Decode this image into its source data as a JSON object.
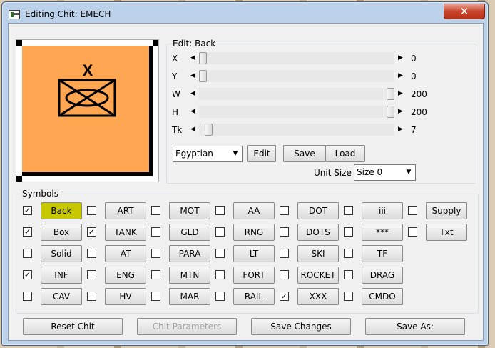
{
  "window": {
    "title": "Editing Chit: EMECH",
    "close_label": "✕"
  },
  "background_tiles": [
    "4 5 5",
    "4 5 5",
    "6 5 9",
    "3 2 12",
    "4 7"
  ],
  "preview": {
    "unit_mark": "X",
    "fill_color": "#fea651"
  },
  "edit_group": {
    "title": "Edit: Back",
    "sliders": [
      {
        "label": "X",
        "value": "0",
        "level": 0.0
      },
      {
        "label": "Y",
        "value": "0",
        "level": 0.0
      },
      {
        "label": "W",
        "value": "200",
        "level": 1.0
      },
      {
        "label": "H",
        "value": "200",
        "level": 1.0
      },
      {
        "label": "Tk",
        "value": "7",
        "level": 0.03
      }
    ],
    "nationality": "Egyptian",
    "edit_label": "Edit",
    "save_label": "Save",
    "load_label": "Load",
    "unit_size_label": "Unit Size",
    "unit_size_value": "Size 0"
  },
  "symbols": {
    "title": "Symbols",
    "rows": [
      [
        {
          "label": "Back",
          "checked": true,
          "selected": true
        },
        {
          "label": "ART",
          "checked": false
        },
        {
          "label": "MOT",
          "checked": false
        },
        {
          "label": "AA",
          "checked": false
        },
        {
          "label": "DOT",
          "checked": false
        },
        {
          "label": "iii",
          "checked": false
        },
        {
          "label": "Supply",
          "checked": false
        }
      ],
      [
        {
          "label": "Box",
          "checked": true
        },
        {
          "label": "TANK",
          "checked": true
        },
        {
          "label": "GLD",
          "checked": false
        },
        {
          "label": "RNG",
          "checked": false
        },
        {
          "label": "DOTS",
          "checked": false
        },
        {
          "label": "***",
          "checked": false
        },
        {
          "label": "Txt",
          "checked": false
        }
      ],
      [
        {
          "label": "Solid",
          "checked": false
        },
        {
          "label": "AT",
          "checked": false
        },
        {
          "label": "PARA",
          "checked": false
        },
        {
          "label": "LT",
          "checked": false
        },
        {
          "label": "SKI",
          "checked": false
        },
        {
          "label": "TF",
          "checked": false
        }
      ],
      [
        {
          "label": "INF",
          "checked": true
        },
        {
          "label": "ENG",
          "checked": false
        },
        {
          "label": "MTN",
          "checked": false
        },
        {
          "label": "FORT",
          "checked": false
        },
        {
          "label": "ROCKET",
          "checked": false
        },
        {
          "label": "DRAG",
          "checked": false
        }
      ],
      [
        {
          "label": "CAV",
          "checked": false
        },
        {
          "label": "HV",
          "checked": false
        },
        {
          "label": "MAR",
          "checked": false
        },
        {
          "label": "RAIL",
          "checked": false
        },
        {
          "label": "XXX",
          "checked": true
        },
        {
          "label": "CMDO",
          "checked": false
        }
      ]
    ]
  },
  "footer": {
    "reset_label": "Reset Chit",
    "params_label": "Chit Parameters",
    "save_changes_label": "Save Changes",
    "save_as_label": "Save As:"
  },
  "colors": {
    "selected_button": "#c8c800",
    "chit_orange": "#fea651",
    "close_red": "#c8442c"
  }
}
